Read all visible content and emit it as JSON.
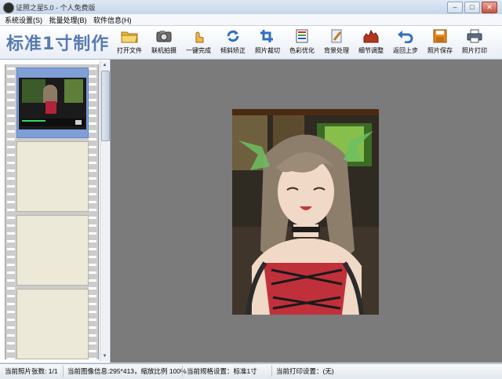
{
  "window": {
    "title": "证照之星5.0 - 个人免费版",
    "minimize": "–",
    "maximize": "□",
    "close": "✕"
  },
  "menu": [
    {
      "label": "系统设置(S)"
    },
    {
      "label": "批量处理(B)"
    },
    {
      "label": "软件信息(H)"
    }
  ],
  "toolbar": {
    "brand": "标准1寸制作",
    "buttons": [
      {
        "label": "打开文件",
        "icon": "folder-icon"
      },
      {
        "label": "联机拍摄",
        "icon": "camera-icon"
      },
      {
        "label": "一键完成",
        "icon": "hand-icon"
      },
      {
        "label": "倾斜矫正",
        "icon": "rotate-icon"
      },
      {
        "label": "照片裁切",
        "icon": "crop-icon"
      },
      {
        "label": "色彩优化",
        "icon": "color-bars-icon"
      },
      {
        "label": "背景处理",
        "icon": "brush-icon"
      },
      {
        "label": "细节调整",
        "icon": "histogram-icon"
      },
      {
        "label": "返回上步",
        "icon": "undo-icon"
      },
      {
        "label": "照片保存",
        "icon": "save-icon"
      },
      {
        "label": "照片打印",
        "icon": "printer-icon"
      }
    ]
  },
  "filmstrip": {
    "frames": 4,
    "selected": 0
  },
  "status": {
    "count": "当前照片张数: 1/1",
    "info": "当前图像信息:295*413，缩放比例 100%",
    "spec": "当前规格设置：标准1寸",
    "print": "当前打印设置：(无)"
  },
  "colors": {
    "brand": "#587bb0",
    "workspace": "#7b7b7b",
    "film": "#cccccc"
  }
}
